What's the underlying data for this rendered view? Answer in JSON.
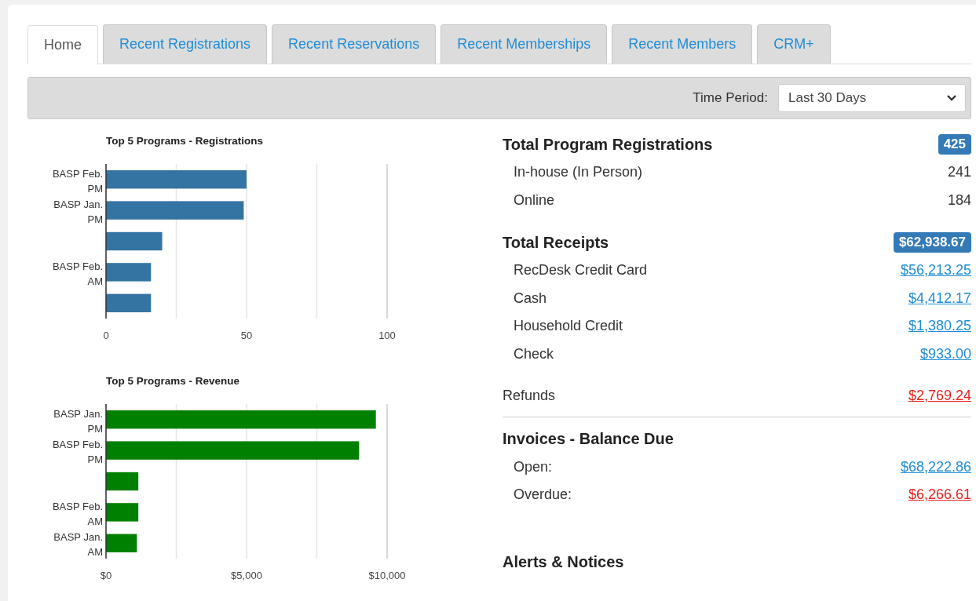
{
  "tabs": [
    {
      "label": "Home",
      "selected": true
    },
    {
      "label": "Recent Registrations",
      "selected": false
    },
    {
      "label": "Recent Reservations",
      "selected": false
    },
    {
      "label": "Recent Memberships",
      "selected": false
    },
    {
      "label": "Recent Members",
      "selected": false
    },
    {
      "label": "CRM+",
      "selected": false
    }
  ],
  "filter": {
    "label": "Time Period:",
    "value": "Last 30 Days"
  },
  "charts": [
    {
      "chart_data": {
        "type": "bar",
        "orientation": "horizontal",
        "title": "Top 5 Programs - Registrations",
        "categories": [
          "BASP Feb. PM",
          "BASP Jan. PM",
          null,
          "BASP Feb. AM",
          null
        ],
        "grid": true,
        "series": [
          {
            "color": "#3474a2",
            "values": [
              50,
              49,
              20,
              16,
              16
            ]
          }
        ],
        "xlim": [
          0,
          100
        ],
        "xticks": [
          {
            "value": 0,
            "label": "0"
          },
          {
            "value": 25,
            "label": null
          },
          {
            "value": 50,
            "label": "50"
          },
          {
            "value": 75,
            "label": null
          },
          {
            "value": 100,
            "label": "100"
          }
        ]
      }
    },
    {
      "chart_data": {
        "type": "bar",
        "orientation": "horizontal",
        "title": "Top 5 Programs - Revenue",
        "categories": [
          "BASP Jan. PM",
          "BASP Feb. PM",
          null,
          "BASP Feb. AM",
          "BASP Jan. AM"
        ],
        "grid": true,
        "series": [
          {
            "color": "#008000",
            "values": [
              9600,
              9000,
              1150,
              1150,
              1100
            ]
          }
        ],
        "xlim": [
          0,
          10000
        ],
        "xticks": [
          {
            "value": 0,
            "label": "$0"
          },
          {
            "value": 2500,
            "label": null
          },
          {
            "value": 5000,
            "label": "$5,000"
          },
          {
            "value": 7500,
            "label": null
          },
          {
            "value": 10000,
            "label": "$10,000"
          }
        ]
      }
    }
  ],
  "summary": [
    {
      "title": "Total Program Registrations",
      "badge": "425",
      "rows": [
        {
          "label": "In-house (In Person)",
          "value": "241",
          "kind": "count"
        },
        {
          "label": "Online",
          "value": "184",
          "kind": "count"
        }
      ]
    },
    {
      "title": "Total Receipts",
      "badge": "$62,938.67",
      "rows": [
        {
          "label": "RecDesk Credit Card",
          "value": "$56,213.25",
          "kind": "link"
        },
        {
          "label": "Cash",
          "value": "$4,412.17",
          "kind": "link"
        },
        {
          "label": "Household Credit",
          "value": "$1,380.25",
          "kind": "link"
        },
        {
          "label": "Check",
          "value": "$933.00",
          "kind": "link"
        }
      ]
    }
  ],
  "refunds": {
    "label": "Refunds",
    "value": "$2,769.24"
  },
  "invoices": {
    "title": "Invoices - Balance Due",
    "rows": [
      {
        "label": "Open:",
        "value": "$68,222.86",
        "kind": "link"
      },
      {
        "label": "Overdue:",
        "value": "$6,266.61",
        "kind": "alert"
      }
    ]
  },
  "alerts": {
    "title": "Alerts & Notices"
  }
}
